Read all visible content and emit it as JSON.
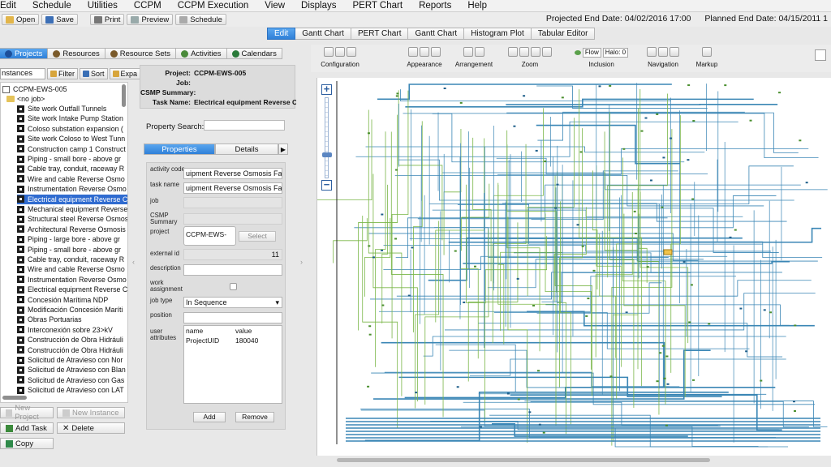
{
  "menubar": {
    "items": [
      "Edit",
      "Schedule",
      "Utilities",
      "CCPM",
      "CCPM Execution",
      "View",
      "Displays",
      "PERT Chart",
      "Reports",
      "Help"
    ]
  },
  "toolbar": {
    "open": "Open",
    "save": "Save",
    "print": "Print",
    "preview": "Preview",
    "schedule": "Schedule"
  },
  "dates": {
    "projected": "Projected End Date: 04/02/2016 17:00",
    "planned": "Planned End Date: 04/15/2011 1"
  },
  "view_tabs": [
    "Edit",
    "Gantt Chart",
    "PERT Chart",
    "Gantt Chart",
    "Histogram Plot",
    "Tabular Editor"
  ],
  "left_tabs": [
    "Projects",
    "Resources",
    "Resource Sets",
    "Activities",
    "Calendars"
  ],
  "filterbar": {
    "instances": "nstances",
    "filter": "Filter",
    "sort": "Sort",
    "expand": "Expa"
  },
  "tree": {
    "root": "CCPM-EWS-005",
    "nojob": "<no job>",
    "items": [
      "Site work Outfall Tunnels",
      "Site work Intake Pump Station",
      "Coloso substation expansion (",
      "Site work Coloso to West Tunn",
      "Construction camp 1 Construct",
      "Piping - small bore - above gr",
      "Cable tray, conduit, raceway R",
      "Wire and cable Reverse Osmo",
      "Instrumentation Reverse Osmo",
      "Electrical equipment Reverse C",
      "Mechanical equipment Reverse",
      "Structural steel Reverse Osmos",
      "Architectural Reverse Osmosis",
      "Piping - large bore - above gr",
      "Piping - small bore - above gr",
      "Cable tray, conduit, raceway R",
      "Wire and cable Reverse Osmo",
      "Instrumentation Reverse Osmo",
      "Electrical equipment Reverse C",
      "Concesión Marítima NDP",
      "Modificación Concesión Maríti",
      "Obras Portuarias",
      "Interconexión sobre 23>kV",
      "Construcción de Obra Hidráuli",
      "Construcción de Obra Hidráuli",
      "Solicitud de Atravieso con Nor",
      "Solicitud de Atravieso con Blan",
      "Solicitud de Atravieso con Gas",
      "Solicitud de Atravieso con LAT"
    ],
    "selected_index": 9
  },
  "left_buttons": {
    "new_project": "New Project",
    "new_instance": "New Instance",
    "add_task": "Add Task",
    "delete": "Delete",
    "copy": "Copy"
  },
  "summary": {
    "project_k": "Project:",
    "project_v": "CCPM-EWS-005",
    "job_k": "Job:",
    "job_v": "",
    "csmp_k": "CSMP Summary:",
    "csmp_v": "",
    "task_k": "Task Name:",
    "task_v": "Electrical equipment Reverse Os..."
  },
  "property_search": {
    "label": "Property Search:",
    "value": ""
  },
  "prop_tabs": {
    "properties": "Properties",
    "details": "Details",
    "arrow": "▶"
  },
  "form": {
    "activity_code_l": "activity code",
    "activity_code_v": "uipment Reverse Osmosis Fa",
    "task_name_l": "task name",
    "task_name_v": "uipment Reverse Osmosis Fa",
    "job_l": "job",
    "csmp_l": "CSMP Summary",
    "project_l": "project",
    "project_v": "CCPM-EWS-",
    "select_btn": "Select",
    "external_id_l": "external id",
    "external_id_v": "11",
    "description_l": "description",
    "work_assignment_l": "work assignment",
    "job_type_l": "job type",
    "job_type_v": "In Sequence",
    "position_l": "position",
    "user_attr_l": "user attributes",
    "ua_name_h": "name",
    "ua_value_h": "value",
    "ua_name": "ProjectUID",
    "ua_value": "180040",
    "add_btn": "Add",
    "remove_btn": "Remove"
  },
  "pert_toolbar": {
    "configuration": "Configuration",
    "appearance": "Appearance",
    "arrangement": "Arrangement",
    "zoom": "Zoom",
    "inclusion": "Inclusion",
    "flow": "Flow",
    "halo": "Halo: 0",
    "navigation": "Navigation",
    "markup": "Markup"
  },
  "colors": {
    "accent": "#2f80d8",
    "edge_blue": "#3a86b5",
    "edge_green": "#7ab648"
  }
}
